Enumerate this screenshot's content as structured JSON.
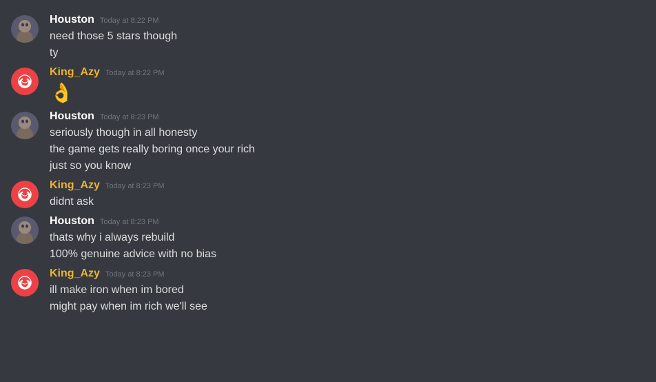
{
  "messages": [
    {
      "id": "msg1",
      "author": "Houston",
      "authorType": "houston",
      "timestamp": "Today at 8:22 PM",
      "lines": [
        "need those 5 stars though",
        "ty"
      ]
    },
    {
      "id": "msg2",
      "author": "King_Azy",
      "authorType": "king",
      "timestamp": "Today at 8:22 PM",
      "lines": [
        "👌"
      ]
    },
    {
      "id": "msg3",
      "author": "Houston",
      "authorType": "houston",
      "timestamp": "Today at 8:23 PM",
      "lines": [
        "seriously though in all honesty",
        "the game gets really boring once your rich",
        "just so you know"
      ]
    },
    {
      "id": "msg4",
      "author": "King_Azy",
      "authorType": "king",
      "timestamp": "Today at 8:23 PM",
      "lines": [
        "didnt ask"
      ]
    },
    {
      "id": "msg5",
      "author": "Houston",
      "authorType": "houston",
      "timestamp": "Today at 8:23 PM",
      "lines": [
        "thats why i always rebuild",
        "100% genuine advice with no bias"
      ]
    },
    {
      "id": "msg6",
      "author": "King_Azy",
      "authorType": "king",
      "timestamp": "Today at 8:23 PM",
      "lines": [
        "ill make iron when im bored",
        "might pay when im rich we'll see"
      ]
    }
  ]
}
